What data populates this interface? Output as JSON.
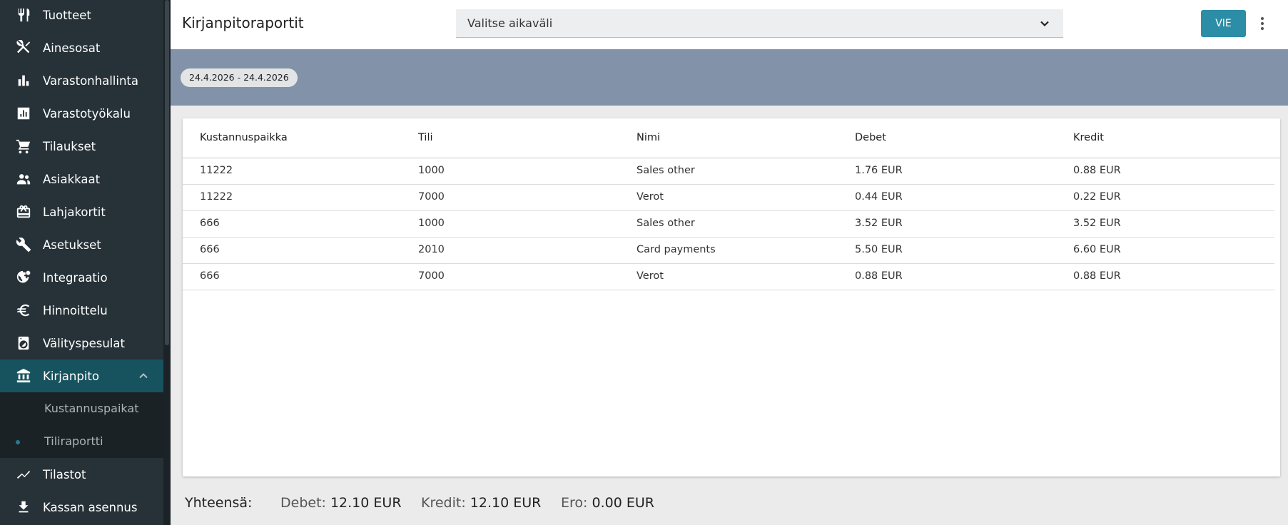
{
  "sidebar": {
    "items": [
      {
        "label": "Tuotteet",
        "icon": "fork-knife-icon"
      },
      {
        "label": "Ainesosat",
        "icon": "utensils-cross-icon"
      },
      {
        "label": "Varastonhallinta",
        "icon": "bar-chart-icon"
      },
      {
        "label": "Varastotyökalu",
        "icon": "analytics-icon"
      },
      {
        "label": "Tilaukset",
        "icon": "cart-icon"
      },
      {
        "label": "Asiakkaat",
        "icon": "people-icon"
      },
      {
        "label": "Lahjakortit",
        "icon": "gift-card-icon"
      },
      {
        "label": "Asetukset",
        "icon": "wrench-icon"
      },
      {
        "label": "Integraatio",
        "icon": "globe-gear-icon"
      },
      {
        "label": "Hinnoittelu",
        "icon": "euro-icon"
      },
      {
        "label": "Välityspesulat",
        "icon": "washing-machine-icon"
      },
      {
        "label": "Kirjanpito",
        "icon": "bank-icon"
      },
      {
        "label": "Tilastot",
        "icon": "trend-line-icon"
      },
      {
        "label": "Kassan asennus",
        "icon": "download-icon"
      }
    ],
    "subitems": [
      {
        "label": "Kustannuspaikat"
      },
      {
        "label": "Tiliraportti"
      }
    ]
  },
  "header": {
    "title": "Kirjanpitoraportit",
    "period_placeholder": "Valitse aikaväli",
    "export_label": "VIE"
  },
  "date_chip": "24.4.2026 - 24.4.2026",
  "table": {
    "columns": [
      "Kustannuspaikka",
      "Tili",
      "Nimi",
      "Debet",
      "Kredit"
    ],
    "rows": [
      [
        "11222",
        "1000",
        "Sales other",
        "1.76 EUR",
        "0.88 EUR"
      ],
      [
        "11222",
        "7000",
        "Verot",
        "0.44 EUR",
        "0.22 EUR"
      ],
      [
        "666",
        "1000",
        "Sales other",
        "3.52 EUR",
        "3.52 EUR"
      ],
      [
        "666",
        "2010",
        "Card payments",
        "5.50 EUR",
        "6.60 EUR"
      ],
      [
        "666",
        "7000",
        "Verot",
        "0.88 EUR",
        "0.88 EUR"
      ]
    ]
  },
  "totals": {
    "label": "Yhteensä:",
    "debit_label": "Debet:",
    "debit_value": "12.10 EUR",
    "credit_label": "Kredit:",
    "credit_value": "12.10 EUR",
    "diff_label": "Ero:",
    "diff_value": "0.00 EUR"
  },
  "colors": {
    "sidebar_bg": "#263238",
    "active_item_bg": "#17535e",
    "date_band_bg": "#8292a8",
    "accent": "#2c8ea6"
  }
}
